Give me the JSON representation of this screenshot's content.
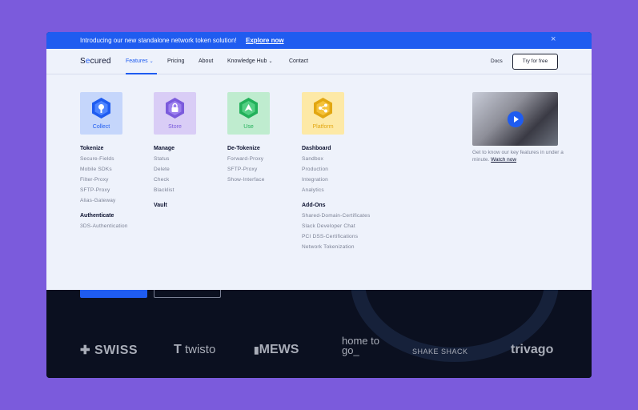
{
  "announcement": {
    "text": "Introducing our new standalone network token solution!",
    "link": "Explore now",
    "close": "×"
  },
  "nav": {
    "logo_prefix": "S",
    "logo_accent": "e",
    "logo_suffix": "cured",
    "items": [
      {
        "label": "Features",
        "chevron": "⌄"
      },
      {
        "label": "Pricing"
      },
      {
        "label": "About"
      },
      {
        "label": "Knowledge Hub",
        "chevron": "⌄"
      },
      {
        "label": "Contact"
      }
    ],
    "docs": "Docs",
    "try": "Try for free"
  },
  "columns": [
    {
      "tile": {
        "label": "Collect",
        "bg": "#c5d6fb",
        "fg": "#1f5cf0",
        "icon": "bulb-icon"
      },
      "groups": [
        {
          "heading": "Tokenize",
          "links": [
            "Secure-Fields",
            "Mobile SDKs",
            "Filter-Proxy",
            "SFTP-Proxy",
            "Alias-Gateway"
          ]
        },
        {
          "heading": "Authenticate",
          "links": [
            "3DS-Authentication"
          ]
        }
      ]
    },
    {
      "tile": {
        "label": "Store",
        "bg": "#d9cdf6",
        "fg": "#7b5bdc",
        "icon": "lock-icon"
      },
      "groups": [
        {
          "heading": "Manage",
          "links": [
            "Status",
            "Delete",
            "Check",
            "Blacklist"
          ]
        },
        {
          "heading": "Vault",
          "links": []
        }
      ]
    },
    {
      "tile": {
        "label": "Use",
        "bg": "#bfeccf",
        "fg": "#22b05a",
        "icon": "arrow-up-icon"
      },
      "groups": [
        {
          "heading": "De-Tokenize",
          "links": [
            "Forward-Proxy",
            "SFTP-Proxy",
            "Show-Interface"
          ]
        }
      ]
    },
    {
      "tile": {
        "label": "Platform",
        "bg": "#fde9a6",
        "fg": "#e2a712",
        "icon": "share-icon"
      },
      "groups": [
        {
          "heading": "Dashboard",
          "links": [
            "Sandbox",
            "Production",
            "Integration",
            "Analytics"
          ]
        },
        {
          "heading": "Add-Ons",
          "links": [
            "Shared-Domain-Certificates",
            "Slack Developer Chat",
            "PCI DSS-Certifications",
            "Network Tokenization"
          ]
        }
      ]
    }
  ],
  "video": {
    "caption": "Get to know our key features in under a minute.",
    "watch": "Watch now"
  },
  "brands": [
    "SWISS",
    "twisto",
    "MEWS",
    "home to go_",
    "SHAKE SHACK",
    "trivago"
  ],
  "colors": {
    "accent": "#1f5cf0",
    "purple_bg": "#7b5bdc",
    "dark": "#0b1020"
  }
}
